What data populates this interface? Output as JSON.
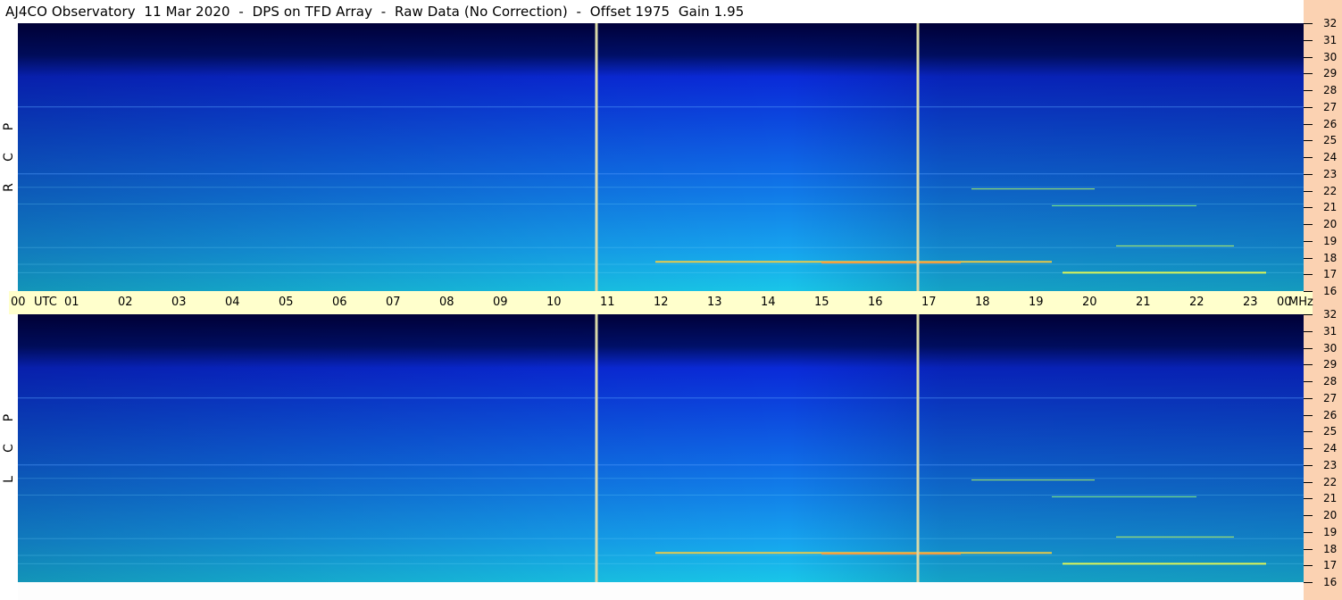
{
  "header": {
    "title": "AJ4CO Observatory  11 Mar 2020  -  DPS on TFD Array  -  Raw Data (No Correction)  -  Offset 1975  Gain 1.95"
  },
  "panels": [
    {
      "id": "rcp",
      "letters": [
        "P",
        "C",
        "R"
      ]
    },
    {
      "id": "lcp",
      "letters": [
        "P",
        "C",
        "L"
      ]
    }
  ],
  "chart_data": {
    "type": "heatmap",
    "title": "AJ4CO Observatory  11 Mar 2020  -  DPS on TFD Array  -  Raw Data (No Correction)  -  Offset 1975  Gain 1.95",
    "x_axis": {
      "unit": "UTC",
      "range_hours": [
        0,
        24
      ],
      "ticks": [
        "00",
        "01",
        "02",
        "03",
        "04",
        "05",
        "06",
        "07",
        "08",
        "09",
        "10",
        "11",
        "12",
        "13",
        "14",
        "15",
        "16",
        "17",
        "18",
        "19",
        "20",
        "21",
        "22",
        "23",
        "00"
      ]
    },
    "y_axis": {
      "unit": "MHz",
      "range": [
        16,
        32
      ],
      "ticks": [
        "16",
        "17",
        "18",
        "19",
        "20",
        "21",
        "22",
        "23",
        "24",
        "25",
        "26",
        "27",
        "28",
        "29",
        "30",
        "31",
        "32"
      ]
    },
    "series": [
      {
        "name": "RCP",
        "markers_utc_hours": [
          10.8,
          16.8
        ]
      },
      {
        "name": "LCP",
        "markers_utc_hours": [
          10.8,
          16.8
        ]
      }
    ],
    "colors": {
      "background": "#00003a",
      "low": "#0a2ad8",
      "mid": "#16a4ee",
      "high": "#ffd23a",
      "axis_band": "#ffffcc",
      "side_band": "#fbd2b2"
    }
  }
}
